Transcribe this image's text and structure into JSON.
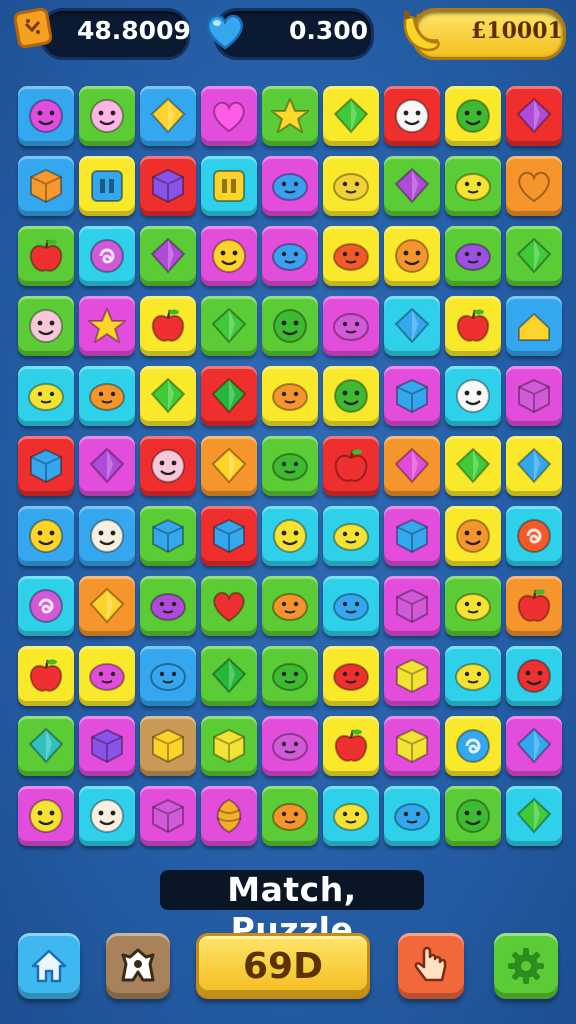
{
  "hud": {
    "score": {
      "value": "48.8009",
      "icon": "cracker-icon"
    },
    "lives": {
      "value": "0.300",
      "icon": "heart-icon"
    },
    "coins": {
      "value": "£10001",
      "icon": "banana-icon"
    }
  },
  "title": "Match, Puzzle",
  "bottom_bar": {
    "home": {
      "icon": "home-icon"
    },
    "character": {
      "icon": "character-icon"
    },
    "play": {
      "label": "69D"
    },
    "tap": {
      "icon": "hand-tap-icon"
    },
    "settings": {
      "icon": "gear-icon"
    }
  },
  "colors": {
    "blue": "#35a7ef",
    "green": "#5ccc36",
    "cyan": "#2fd0ea",
    "magenta": "#e24ddc",
    "yellow": "#f9e92a",
    "red": "#ef2e2e",
    "orange": "#f5952b",
    "purple": "#a653e8",
    "tan": "#c99a55",
    "light": "#eafcff"
  },
  "board": {
    "rows": 11,
    "cols": 9,
    "tiles": [
      [
        "blue:face:#e14de0",
        "green:face:#ffb5e6",
        "blue:gem:#ffd42a",
        "magenta:heart:#ff5ae8",
        "green:star:#ffd82a",
        "yellow:gem:#3fcb39",
        "red:face:#f8f8f8",
        "yellow:face:#3dba2f",
        "red:gem:#b04ad9"
      ],
      [
        "blue:cube:#f79a2d",
        "yellow:square:#35a7ef",
        "red:cube:#8a52e8",
        "cyan:square:#ffd42a",
        "magenta:blob:#3aa0f0",
        "yellow:blob:#f2d137",
        "green:gem:#b04ad9",
        "green:blob:#f5e334",
        "orange:heart:#f5952b"
      ],
      [
        "green:apple:#ef3030",
        "cyan:swirl:#d25ad8",
        "green:gem:#b04ad9",
        "magenta:face:#ffd42a",
        "magenta:blob:#3aa0f0",
        "yellow:blob:#f25a2a",
        "yellow:face:#f5952b",
        "green:blob:#9b50e0",
        "green:gem:#3fcb39"
      ],
      [
        "green:face:#f8c8d8",
        "magenta:star:#ffd42a",
        "yellow:apple:#ef3030",
        "green:gem:#3fcb39",
        "green:face:#3dba2f",
        "magenta:blob:#d25ad8",
        "cyan:gem:#35a7ef",
        "yellow:apple:#ef3030",
        "blue:house:#ffd42a"
      ],
      [
        "cyan:blob:#f5e334",
        "cyan:blob:#f5952b",
        "yellow:gem:#3fcb39",
        "red:gem:#26b83a",
        "yellow:blob:#f5952b",
        "yellow:face:#3dba2f",
        "magenta:cube:#35a7ef",
        "cyan:face:#f8f8f8",
        "magenta:cube:#d25ad8"
      ],
      [
        "red:cube:#35a7ef",
        "magenta:gem:#b04ad9",
        "red:face:#f8c8d8",
        "orange:gem:#ffd42a",
        "green:blob:#3dba2f",
        "red:apple:#ef3030",
        "orange:gem:#e04dd8",
        "yellow:gem:#3fcb39",
        "yellow:gem:#35a7ef"
      ],
      [
        "blue:face:#ffd42a",
        "blue:face:#f8f0e0",
        "green:cube:#35a7ef",
        "red:cube:#35a7ef",
        "cyan:face:#f5e334",
        "cyan:blob:#f5e334",
        "magenta:cube:#35a7ef",
        "yellow:face:#f5952b",
        "cyan:swirl:#f25a2a"
      ],
      [
        "cyan:swirl:#d25ad8",
        "orange:gem:#ffd42a",
        "green:blob:#b04ad9",
        "green:heart:#ef3030",
        "green:blob:#f5952b",
        "cyan:blob:#35a7ef",
        "magenta:cube:#d25ad8",
        "green:blob:#f5e334",
        "orange:apple:#ef3030"
      ],
      [
        "yellow:apple:#ef3030",
        "yellow:blob:#e04dd8",
        "blue:blob:#35a7ef",
        "green:gem:#26b83a",
        "green:blob:#3dba2f",
        "yellow:blob:#ef3030",
        "magenta:cube:#f5e334",
        "cyan:blob:#f5e334",
        "cyan:face:#ef3030"
      ],
      [
        "green:gem:#2fc0c0",
        "magenta:cube:#8a52e8",
        "tan:cube:#ffd42a",
        "green:cube:#f5e334",
        "magenta:blob:#d25ad8",
        "yellow:apple:#ef3030",
        "magenta:cube:#f5e334",
        "yellow:swirl:#35a7ef",
        "magenta:gem:#35a7ef"
      ],
      [
        "magenta:face:#f5e334",
        "cyan:face:#f8f0e0",
        "magenta:cube:#d25ad8",
        "magenta:shell:#f5b02a",
        "green:blob:#f5952b",
        "cyan:blob:#f5e334",
        "cyan:blob:#35a7ef",
        "green:face:#3dba2f",
        "cyan:gem:#3fcb39"
      ]
    ]
  }
}
